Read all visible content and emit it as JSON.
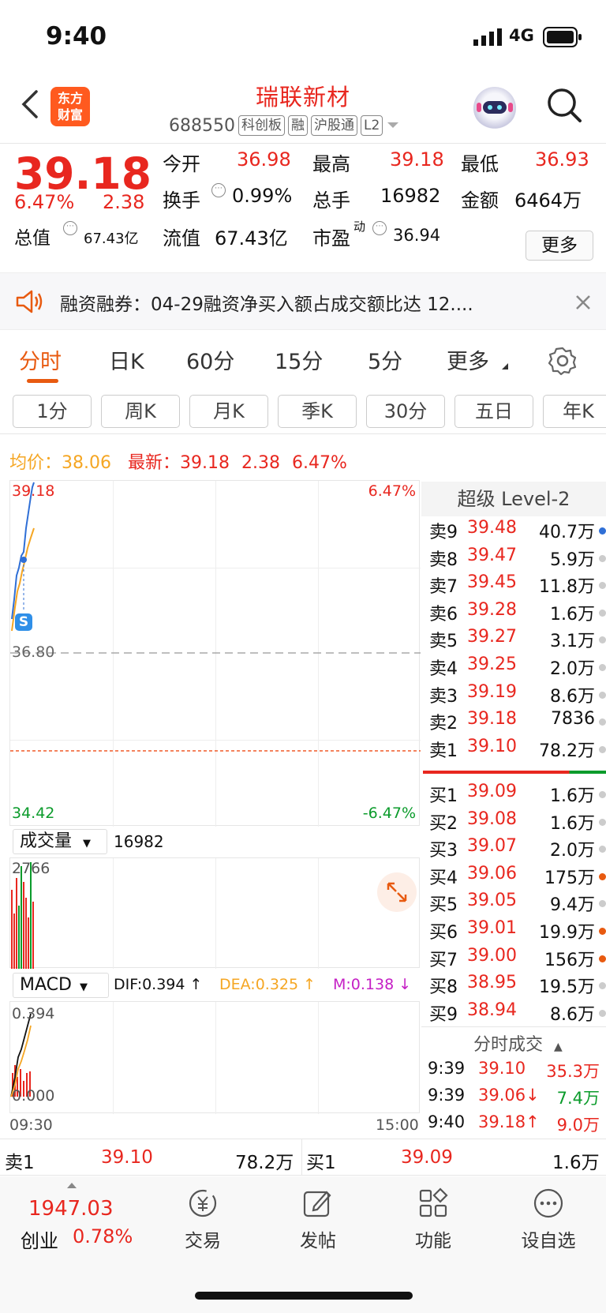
{
  "status_bar": {
    "time": "9:40",
    "network": "4G"
  },
  "header": {
    "name": "瑞联新材",
    "code": "688550",
    "tags": [
      "科创板",
      "融",
      "沪股通",
      "L2"
    ],
    "logo_line1": "东方",
    "logo_line2": "财富"
  },
  "quote": {
    "price": "39.18",
    "change_pct": "6.47%",
    "change": "2.38",
    "open_label": "今开",
    "open": "36.98",
    "high_label": "最高",
    "high": "39.18",
    "low_label": "最低",
    "low": "36.93",
    "turnover_label": "换手",
    "turnover": "0.99%",
    "volume_label": "总手",
    "volume": "16982",
    "amount_label": "金额",
    "amount": "6464万",
    "mktcap_label": "总值",
    "mktcap": "67.43亿",
    "float_label": "流值",
    "float": "67.43亿",
    "pe_label": "市盈",
    "pe_sup": "动",
    "pe": "36.94",
    "more": "更多"
  },
  "notice": {
    "text": "融资融券：04-29融资净买入额占成交额比达 12...."
  },
  "tabs": [
    "分时",
    "日K",
    "60分",
    "15分",
    "5分",
    "更多"
  ],
  "chips": [
    "1分",
    "周K",
    "月K",
    "季K",
    "30分",
    "五日",
    "年K"
  ],
  "avg_line": {
    "avg_label": "均价：",
    "avg": "38.06",
    "latest_label": "最新：",
    "latest": "39.18",
    "change": "2.38",
    "pct": "6.47%"
  },
  "chart": {
    "top_price": "39.18",
    "top_pct": "6.47%",
    "mid_price": "36.80",
    "bottom_price": "34.42",
    "bottom_pct": "-6.47%",
    "s_badge": "S",
    "vol_label": "成交量",
    "vol_value": "16982",
    "vol_max": "2766",
    "macd_label": "MACD",
    "dif": "DIF:0.394 ↑",
    "dea": "DEA:0.325 ↑",
    "m": "M:0.138 ↓",
    "macd_top": "0.394",
    "macd_zero": "0.000",
    "time_start": "09:30",
    "time_end": "15:00"
  },
  "level2": {
    "title": "超级 Level-2",
    "asks": [
      {
        "label": "卖9",
        "price": "39.48",
        "vol": "40.7万",
        "dot": "#2f6fd6"
      },
      {
        "label": "卖8",
        "price": "39.47",
        "vol": "5.9万",
        "dot": "#ccc"
      },
      {
        "label": "卖7",
        "price": "39.45",
        "vol": "11.8万",
        "dot": "#ccc"
      },
      {
        "label": "卖6",
        "price": "39.28",
        "vol": "1.6万",
        "dot": "#ccc"
      },
      {
        "label": "卖5",
        "price": "39.27",
        "vol": "3.1万",
        "dot": "#ccc"
      },
      {
        "label": "卖4",
        "price": "39.25",
        "vol": "2.0万",
        "dot": "#ccc"
      },
      {
        "label": "卖3",
        "price": "39.19",
        "vol": "8.6万",
        "dot": "#ccc"
      },
      {
        "label": "卖2",
        "price": "39.18",
        "vol": "7836",
        "dot": "#ccc"
      },
      {
        "label": "卖1",
        "price": "39.10",
        "vol": "78.2万",
        "dot": "#ccc"
      }
    ],
    "bids": [
      {
        "label": "买1",
        "price": "39.09",
        "vol": "1.6万",
        "dot": "#ccc"
      },
      {
        "label": "买2",
        "price": "39.08",
        "vol": "1.6万",
        "dot": "#ccc"
      },
      {
        "label": "买3",
        "price": "39.07",
        "vol": "2.0万",
        "dot": "#ccc"
      },
      {
        "label": "买4",
        "price": "39.06",
        "vol": "175万",
        "dot": "#e85a10"
      },
      {
        "label": "买5",
        "price": "39.05",
        "vol": "9.4万",
        "dot": "#ccc"
      },
      {
        "label": "买6",
        "price": "39.01",
        "vol": "19.9万",
        "dot": "#e85a10"
      },
      {
        "label": "买7",
        "price": "39.00",
        "vol": "156万",
        "dot": "#e85a10"
      },
      {
        "label": "买8",
        "price": "38.95",
        "vol": "19.5万",
        "dot": "#ccc"
      },
      {
        "label": "买9",
        "price": "38.94",
        "vol": "8.6万",
        "dot": "#ccc"
      }
    ],
    "trades_title": "分时成交",
    "trades": [
      {
        "time": "9:39",
        "price": "39.10",
        "vol": "35.3万"
      },
      {
        "time": "9:39",
        "price": "39.06↓",
        "vol": "7.4万"
      },
      {
        "time": "9:40",
        "price": "39.18↑",
        "vol": "9.0万"
      }
    ]
  },
  "bottom": {
    "ask_label": "卖1",
    "ask_price": "39.10",
    "ask_vol": "78.2万",
    "bid_label": "买1",
    "bid_price": "39.09",
    "bid_vol": "1.6万"
  },
  "nav": {
    "index_value": "1947.03",
    "index_name": "创业",
    "index_pct": "0.78%",
    "items": [
      "交易",
      "发帖",
      "功能",
      "设自选"
    ]
  }
}
